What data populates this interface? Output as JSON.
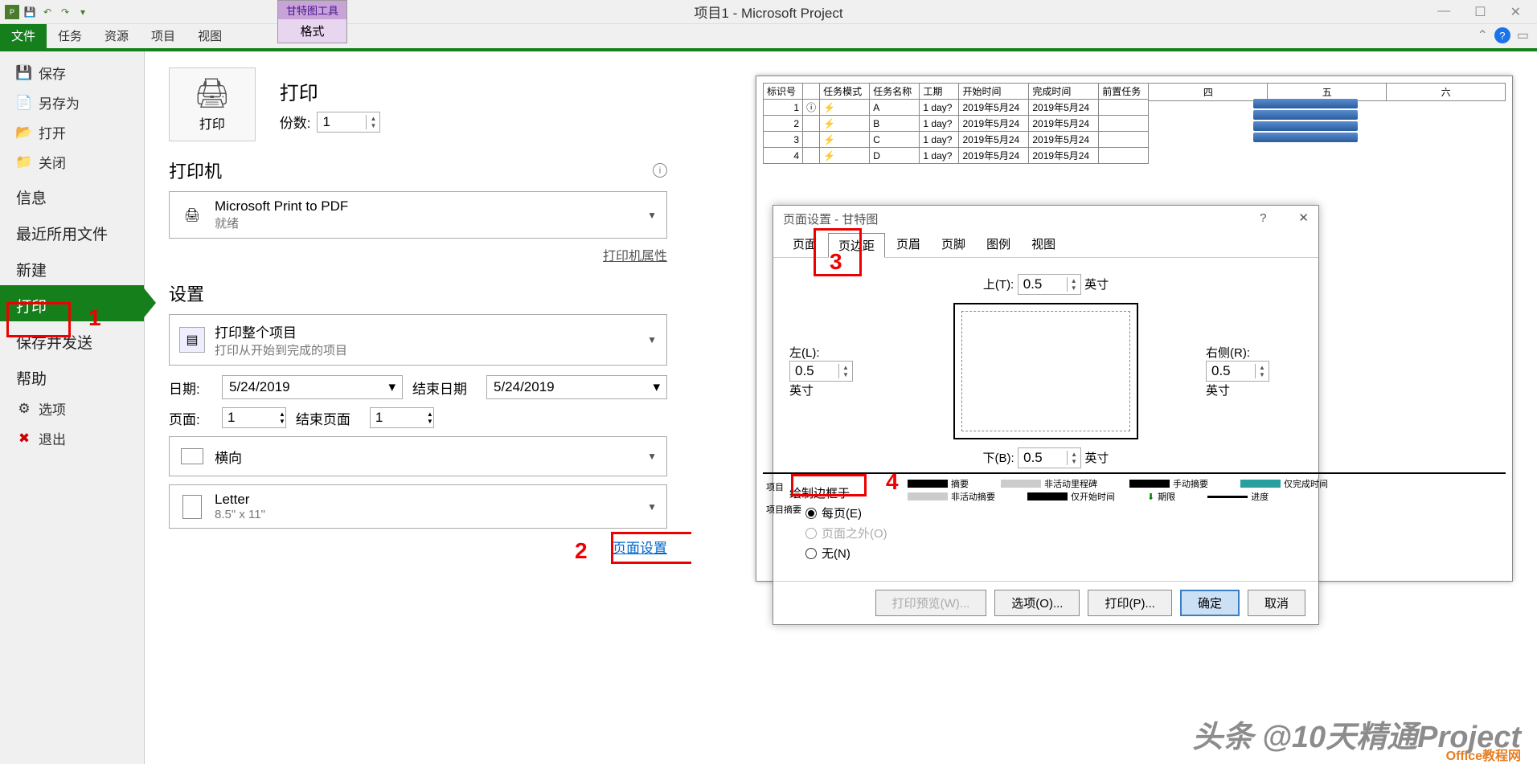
{
  "app_title": "项目1 - Microsoft Project",
  "contextual": {
    "group": "甘特图工具",
    "tab": "格式"
  },
  "ribbon_tabs": [
    "文件",
    "任务",
    "资源",
    "项目",
    "视图"
  ],
  "nav": {
    "save": "保存",
    "saveas": "另存为",
    "open": "打开",
    "close": "关闭",
    "info": "信息",
    "recent": "最近所用文件",
    "new": "新建",
    "print": "打印",
    "send": "保存并发送",
    "help": "帮助",
    "options": "选项",
    "exit": "退出"
  },
  "print": {
    "header": "打印",
    "button": "打印",
    "copies_label": "份数:",
    "copies_value": "1",
    "printer_header": "打印机",
    "printer_name": "Microsoft Print to PDF",
    "printer_status": "就绪",
    "printer_props": "打印机属性",
    "settings_header": "设置",
    "whole_project": "打印整个项目",
    "whole_sub": "打印从开始到完成的项目",
    "date_label": "日期:",
    "date_start": "5/24/2019",
    "date_end_label": "结束日期",
    "date_end": "5/24/2019",
    "page_label": "页面:",
    "page_start": "1",
    "page_end_label": "结束页面",
    "page_end": "1",
    "orientation": "横向",
    "paper": "Letter",
    "paper_size": "8.5\" x 11\"",
    "page_setup_link": "页面设置"
  },
  "annotations": {
    "n1": "1",
    "n2": "2",
    "n3": "3",
    "n4": "4"
  },
  "preview": {
    "cols": [
      "标识号",
      "",
      "任务模式",
      "任务名称",
      "工期",
      "开始时间",
      "完成时间",
      "前置任务"
    ],
    "days": [
      "四",
      "五",
      "六"
    ],
    "rows": [
      {
        "id": "1",
        "name": "A",
        "dur": "1 day?",
        "start": "2019年5月24",
        "end": "2019年5月24"
      },
      {
        "id": "2",
        "name": "B",
        "dur": "1 day?",
        "start": "2019年5月24",
        "end": "2019年5月24"
      },
      {
        "id": "3",
        "name": "C",
        "dur": "1 day?",
        "start": "2019年5月24",
        "end": "2019年5月24"
      },
      {
        "id": "4",
        "name": "D",
        "dur": "1 day?",
        "start": "2019年5月24",
        "end": "2019年5月24"
      }
    ],
    "legend_left_label1": "项目",
    "legend_left_label2": "项目摘要",
    "legend": [
      {
        "label": "摘要",
        "color": "#000"
      },
      {
        "label": "非活动里程碑",
        "color": "#ccc"
      },
      {
        "label": "手动摘要",
        "color": "#000"
      },
      {
        "label": "非活动摘要",
        "color": "#ccc"
      },
      {
        "label": "仅开始时间",
        "color": "#000"
      },
      {
        "label": "仅完成时间",
        "color": "#28a0a0"
      },
      {
        "label": "期限",
        "color": "#080"
      },
      {
        "label": "进度",
        "color": "#000"
      }
    ]
  },
  "dialog": {
    "title": "页面设置 - 甘特图",
    "tabs": [
      "页面",
      "页边距",
      "页眉",
      "页脚",
      "图例",
      "视图"
    ],
    "top_label": "上(T):",
    "top_val": "0.5",
    "unit": "英寸",
    "left_label": "左(L):",
    "left_val": "0.5",
    "right_label": "右侧(R):",
    "right_val": "0.5",
    "bottom_label": "下(B):",
    "bottom_val": "0.5",
    "border_header": "绘制边框于",
    "radio_every": "每页(E)",
    "radio_outside": "页面之外(O)",
    "radio_none": "无(N)",
    "btn_preview": "打印预览(W)...",
    "btn_options": "选项(O)...",
    "btn_print": "打印(P)...",
    "btn_ok": "确定",
    "btn_cancel": "取消"
  },
  "watermark": "头条 @10天精通Project",
  "watermark2": "Office教程网"
}
